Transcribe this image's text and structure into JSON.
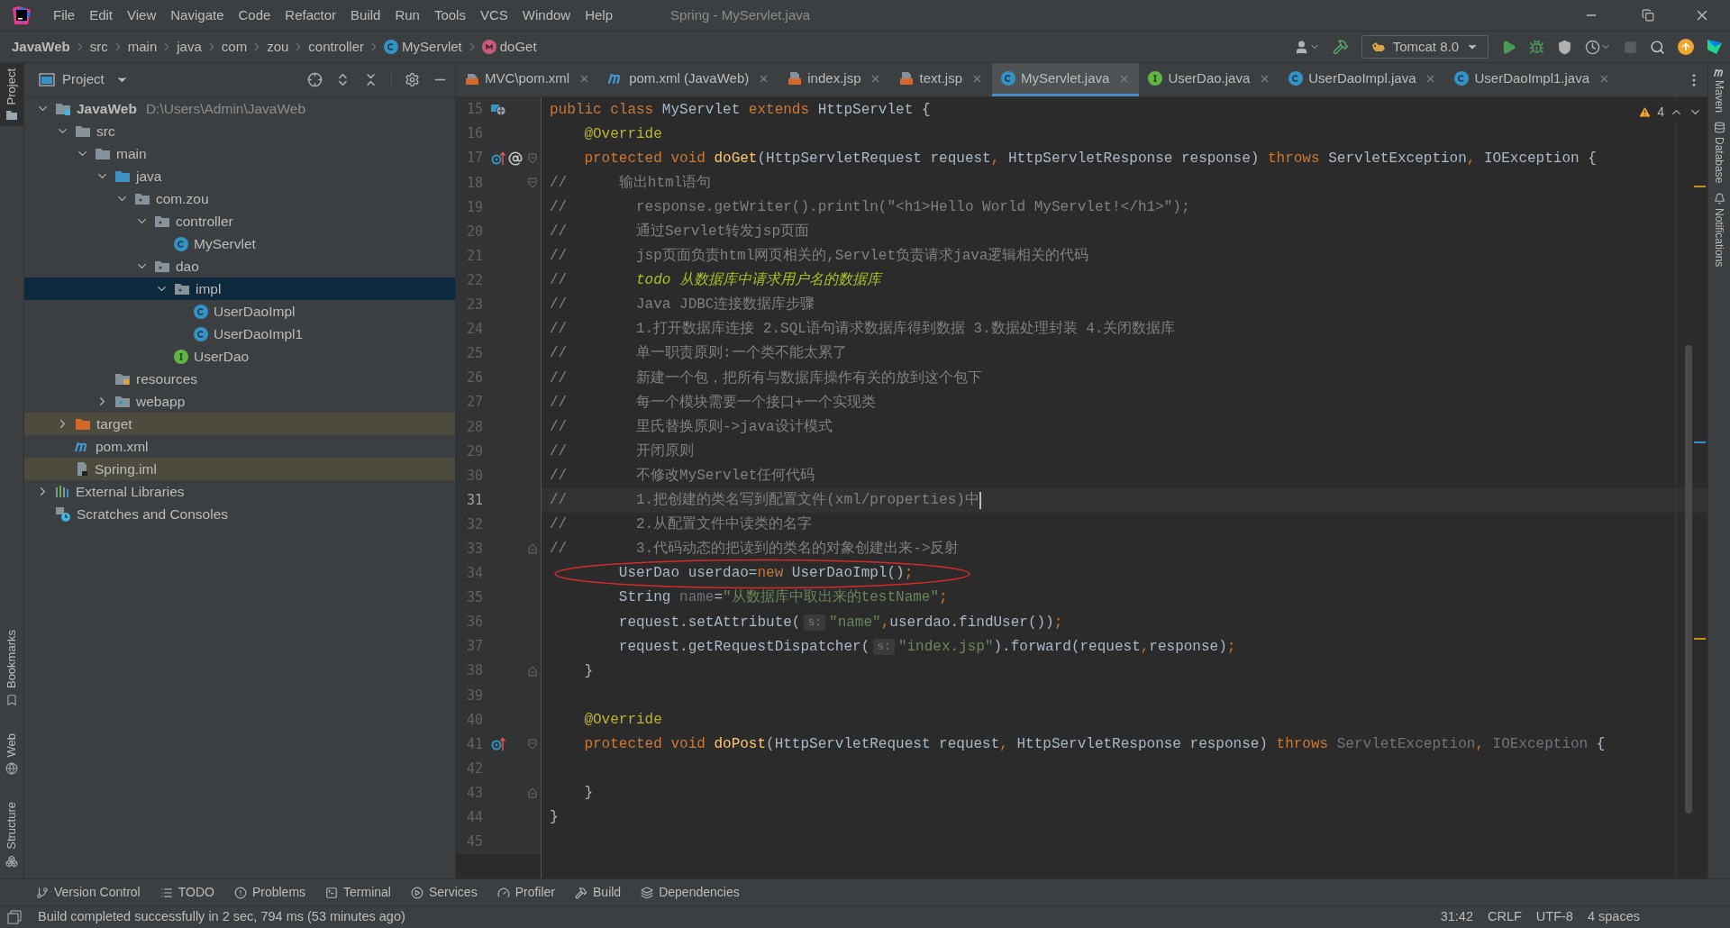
{
  "menu_bar": {
    "items": [
      "File",
      "Edit",
      "View",
      "Navigate",
      "Code",
      "Refactor",
      "Build",
      "Run",
      "Tools",
      "VCS",
      "Window",
      "Help"
    ],
    "title": "Spring - MyServlet.java"
  },
  "breadcrumbs": [
    {
      "label": "JavaWeb",
      "kind": "project"
    },
    {
      "label": "src",
      "kind": "folder"
    },
    {
      "label": "main",
      "kind": "folder"
    },
    {
      "label": "java",
      "kind": "folder"
    },
    {
      "label": "com",
      "kind": "folder"
    },
    {
      "label": "zou",
      "kind": "folder"
    },
    {
      "label": "controller",
      "kind": "folder"
    },
    {
      "label": "MyServlet",
      "kind": "class"
    },
    {
      "label": "doGet",
      "kind": "method"
    }
  ],
  "toolbar": {
    "run_config": "Tomcat 8.0"
  },
  "left_stripe": {
    "top": [
      {
        "label": "Project",
        "kind": "project",
        "selected": true
      }
    ],
    "bottom": [
      {
        "label": "Bookmarks",
        "kind": "bookmarks",
        "selected": false
      },
      {
        "label": "Web",
        "kind": "web",
        "selected": false
      },
      {
        "label": "Structure",
        "kind": "structure",
        "selected": false
      }
    ]
  },
  "project_panel": {
    "title": "Project",
    "tree": [
      {
        "label": "JavaWeb",
        "kind": "module",
        "path": "D:\\Users\\Admin\\JavaWeb",
        "expanded": true,
        "selected": false,
        "excluded": false,
        "children": [
          {
            "label": "src",
            "kind": "folder",
            "expanded": true,
            "selected": false,
            "excluded": false,
            "children": [
              {
                "label": "main",
                "kind": "folder",
                "expanded": true,
                "selected": false,
                "excluded": false,
                "children": [
                  {
                    "label": "java",
                    "kind": "source",
                    "expanded": true,
                    "selected": false,
                    "excluded": false,
                    "children": [
                      {
                        "label": "com.zou",
                        "kind": "package",
                        "expanded": true,
                        "selected": false,
                        "excluded": false,
                        "children": [
                          {
                            "label": "controller",
                            "kind": "package",
                            "expanded": true,
                            "selected": false,
                            "excluded": false,
                            "children": [
                              {
                                "label": "MyServlet",
                                "kind": "class",
                                "selected": false,
                                "excluded": false
                              }
                            ]
                          },
                          {
                            "label": "dao",
                            "kind": "package",
                            "expanded": true,
                            "selected": false,
                            "excluded": false,
                            "children": [
                              {
                                "label": "impl",
                                "kind": "package",
                                "expanded": true,
                                "selected": true,
                                "excluded": false,
                                "children": [
                                  {
                                    "label": "UserDaoImpl",
                                    "kind": "class",
                                    "selected": false,
                                    "excluded": false
                                  },
                                  {
                                    "label": "UserDaoImpl1",
                                    "kind": "class",
                                    "selected": false,
                                    "excluded": false
                                  }
                                ]
                              },
                              {
                                "label": "UserDao",
                                "kind": "interface",
                                "selected": false,
                                "excluded": false
                              }
                            ]
                          }
                        ]
                      }
                    ]
                  },
                  {
                    "label": "resources",
                    "kind": "resources",
                    "selected": false,
                    "excluded": false
                  },
                  {
                    "label": "webapp",
                    "kind": "web",
                    "expanded": false,
                    "selected": false,
                    "excluded": false
                  }
                ]
              }
            ]
          },
          {
            "label": "target",
            "kind": "excluded_folder",
            "expanded": false,
            "selected": false,
            "excluded": true
          },
          {
            "label": "pom.xml",
            "kind": "maven",
            "selected": false,
            "excluded": false
          },
          {
            "label": "Spring.iml",
            "kind": "iml",
            "selected": false,
            "excluded": true
          }
        ]
      },
      {
        "label": "External Libraries",
        "kind": "libraries",
        "expanded": false,
        "selected": false,
        "excluded": false
      },
      {
        "label": "Scratches and Consoles",
        "kind": "scratches",
        "selected": false,
        "excluded": false
      }
    ]
  },
  "editor_tabs": [
    {
      "label": "MVC\\pom.xml",
      "kind": "xml",
      "selected": false
    },
    {
      "label": "pom.xml (JavaWeb)",
      "kind": "maven",
      "selected": false
    },
    {
      "label": "index.jsp",
      "kind": "jsp",
      "selected": false
    },
    {
      "label": "text.jsp",
      "kind": "jsp",
      "selected": false
    },
    {
      "label": "MyServlet.java",
      "kind": "class",
      "selected": true
    },
    {
      "label": "UserDao.java",
      "kind": "interface",
      "selected": false
    },
    {
      "label": "UserDaoImpl.java",
      "kind": "class",
      "selected": false
    },
    {
      "label": "UserDaoImpl1.java",
      "kind": "class",
      "selected": false
    }
  ],
  "editor": {
    "warning_count": "4",
    "markup": {
      "kind": "ellipse"
    },
    "lines": [
      {
        "number": "15",
        "gutter": {
          "kind": "servlet"
        },
        "current": false,
        "tokens": [
          {
            "text": "public class ",
            "kind": "keyword"
          },
          {
            "text": "MyServlet ",
            "kind": "plain"
          },
          {
            "text": "extends ",
            "kind": "keyword"
          },
          {
            "text": "HttpServlet {",
            "kind": "plain"
          }
        ]
      },
      {
        "number": "16",
        "current": false,
        "tokens": [
          {
            "text": "    @Override",
            "kind": "annotation"
          }
        ]
      },
      {
        "number": "17",
        "gutter": {
          "kind": "override_at"
        },
        "fold": {
          "kind": "start"
        },
        "current": false,
        "tokens": [
          {
            "text": "    protected void ",
            "kind": "keyword"
          },
          {
            "text": "doGet",
            "kind": "method"
          },
          {
            "text": "(HttpServletRequest request",
            "kind": "plain"
          },
          {
            "text": ", ",
            "kind": "keyword"
          },
          {
            "text": "HttpServletResponse response) ",
            "kind": "plain"
          },
          {
            "text": "throws ",
            "kind": "keyword"
          },
          {
            "text": "ServletException",
            "kind": "plain"
          },
          {
            "text": ", ",
            "kind": "keyword"
          },
          {
            "text": "IOException {",
            "kind": "plain"
          }
        ]
      },
      {
        "number": "18",
        "fold": {
          "kind": "start"
        },
        "current": false,
        "tokens": [
          {
            "text": "//      输出html语句",
            "kind": "comment"
          }
        ]
      },
      {
        "number": "19",
        "current": false,
        "tokens": [
          {
            "text": "//        response.getWriter().println(\"<h1>Hello World MyServlet!</h1>\");",
            "kind": "comment"
          }
        ]
      },
      {
        "number": "20",
        "current": false,
        "tokens": [
          {
            "text": "//        通过Servlet转发jsp页面",
            "kind": "comment"
          }
        ]
      },
      {
        "number": "21",
        "current": false,
        "tokens": [
          {
            "text": "//        jsp页面负责html网页相关的,Servlet负责请求java逻辑相关的代码",
            "kind": "comment"
          }
        ]
      },
      {
        "number": "22",
        "current": false,
        "tokens": [
          {
            "text": "//        ",
            "kind": "comment"
          },
          {
            "text": "todo 从数据库中请求用户名的数据库",
            "kind": "todo"
          }
        ]
      },
      {
        "number": "23",
        "current": false,
        "tokens": [
          {
            "text": "//        Java JDBC连接数据库步骤",
            "kind": "comment"
          }
        ]
      },
      {
        "number": "24",
        "current": false,
        "tokens": [
          {
            "text": "//        1.打开数据库连接 2.SQL语句请求数据库得到数据 3.数据处理封装 4.关闭数据库",
            "kind": "comment"
          }
        ]
      },
      {
        "number": "25",
        "current": false,
        "tokens": [
          {
            "text": "//        单一职责原则:一个类不能太累了",
            "kind": "comment"
          }
        ]
      },
      {
        "number": "26",
        "current": false,
        "tokens": [
          {
            "text": "//        新建一个包，把所有与数据库操作有关的放到这个包下",
            "kind": "comment"
          }
        ]
      },
      {
        "number": "27",
        "current": false,
        "tokens": [
          {
            "text": "//        每一个模块需要一个接口+一个实现类",
            "kind": "comment"
          }
        ]
      },
      {
        "number": "28",
        "current": false,
        "tokens": [
          {
            "text": "//        里氏替换原则->java设计模式",
            "kind": "comment"
          }
        ]
      },
      {
        "number": "29",
        "current": false,
        "tokens": [
          {
            "text": "//        开闭原则",
            "kind": "comment"
          }
        ]
      },
      {
        "number": "30",
        "current": false,
        "tokens": [
          {
            "text": "//        不修改MyServlet任何代码",
            "kind": "comment"
          }
        ]
      },
      {
        "number": "31",
        "current": true,
        "tokens": [
          {
            "text": "//        1.把创建的类名写到配置文件(xml/properties)中",
            "kind": "comment"
          }
        ]
      },
      {
        "number": "32",
        "current": false,
        "tokens": [
          {
            "text": "//        2.从配置文件中读类的名字",
            "kind": "comment"
          }
        ]
      },
      {
        "number": "33",
        "fold": {
          "kind": "end"
        },
        "current": false,
        "tokens": [
          {
            "text": "//        3.代码动态的把读到的类名的对象创建出来->反射",
            "kind": "comment"
          }
        ]
      },
      {
        "number": "34",
        "current": false,
        "tokens": [
          {
            "text": "        UserDao userdao=",
            "kind": "plain"
          },
          {
            "text": "new ",
            "kind": "keyword"
          },
          {
            "text": "UserDaoImpl()",
            "kind": "plain"
          },
          {
            "text": ";",
            "kind": "keyword"
          }
        ]
      },
      {
        "number": "35",
        "current": false,
        "tokens": [
          {
            "text": "        String ",
            "kind": "plain"
          },
          {
            "text": "name",
            "kind": "unused"
          },
          {
            "text": "=",
            "kind": "plain"
          },
          {
            "text": "\"从数据库中取出来的testName\"",
            "kind": "string"
          },
          {
            "text": ";",
            "kind": "keyword"
          }
        ]
      },
      {
        "number": "36",
        "current": false,
        "tokens": [
          {
            "text": "        request.setAttribute(",
            "kind": "plain"
          },
          {
            "text": "s:",
            "kind": "hint"
          },
          {
            "text": "\"name\"",
            "kind": "string"
          },
          {
            "text": ",",
            "kind": "keyword"
          },
          {
            "text": "userdao.findUser())",
            "kind": "plain"
          },
          {
            "text": ";",
            "kind": "keyword"
          }
        ]
      },
      {
        "number": "37",
        "current": false,
        "tokens": [
          {
            "text": "        request.getRequestDispatcher(",
            "kind": "plain"
          },
          {
            "text": "s:",
            "kind": "hint"
          },
          {
            "text": "\"index.jsp\"",
            "kind": "string"
          },
          {
            "text": ").forward(request",
            "kind": "plain"
          },
          {
            "text": ",",
            "kind": "keyword"
          },
          {
            "text": "response)",
            "kind": "plain"
          },
          {
            "text": ";",
            "kind": "keyword"
          }
        ]
      },
      {
        "number": "38",
        "fold": {
          "kind": "end"
        },
        "current": false,
        "tokens": [
          {
            "text": "    }",
            "kind": "plain"
          }
        ]
      },
      {
        "number": "39",
        "current": false
      },
      {
        "number": "40",
        "current": false,
        "tokens": [
          {
            "text": "    @Override",
            "kind": "annotation"
          }
        ]
      },
      {
        "number": "41",
        "gutter": {
          "kind": "override"
        },
        "fold": {
          "kind": "start"
        },
        "current": false,
        "tokens": [
          {
            "text": "    protected void ",
            "kind": "keyword"
          },
          {
            "text": "doPost",
            "kind": "method"
          },
          {
            "text": "(HttpServletRequest request",
            "kind": "plain"
          },
          {
            "text": ", ",
            "kind": "keyword"
          },
          {
            "text": "HttpServletResponse response) ",
            "kind": "plain"
          },
          {
            "text": "throws ",
            "kind": "keyword"
          },
          {
            "text": "ServletException",
            "kind": "unused"
          },
          {
            "text": ", ",
            "kind": "keyword"
          },
          {
            "text": "IOException",
            "kind": "unused"
          },
          {
            "text": " {",
            "kind": "plain"
          }
        ]
      },
      {
        "number": "42",
        "current": false
      },
      {
        "number": "43",
        "fold": {
          "kind": "end"
        },
        "current": false,
        "tokens": [
          {
            "text": "    }",
            "kind": "plain"
          }
        ]
      },
      {
        "number": "44",
        "current": false,
        "tokens": [
          {
            "text": "}",
            "kind": "plain"
          }
        ]
      },
      {
        "number": "45",
        "current": false
      }
    ]
  },
  "right_stripe": [
    {
      "label": "Maven",
      "kind": "maven"
    },
    {
      "label": "Database",
      "kind": "database"
    },
    {
      "label": "Notifications",
      "kind": "notifications"
    }
  ],
  "tool_tabs": [
    {
      "label": "Version Control",
      "kind": "vcs"
    },
    {
      "label": "TODO",
      "kind": "todo"
    },
    {
      "label": "Problems",
      "kind": "problems"
    },
    {
      "label": "Terminal",
      "kind": "terminal"
    },
    {
      "label": "Services",
      "kind": "services"
    },
    {
      "label": "Profiler",
      "kind": "profiler"
    },
    {
      "label": "Build",
      "kind": "build"
    },
    {
      "label": "Dependencies",
      "kind": "dependencies"
    }
  ],
  "status_bar": {
    "message": "Build completed successfully in 2 sec, 794 ms (53 minutes ago)",
    "position": "31:42",
    "line_separator": "CRLF",
    "encoding": "UTF-8",
    "indent": "4 spaces"
  }
}
